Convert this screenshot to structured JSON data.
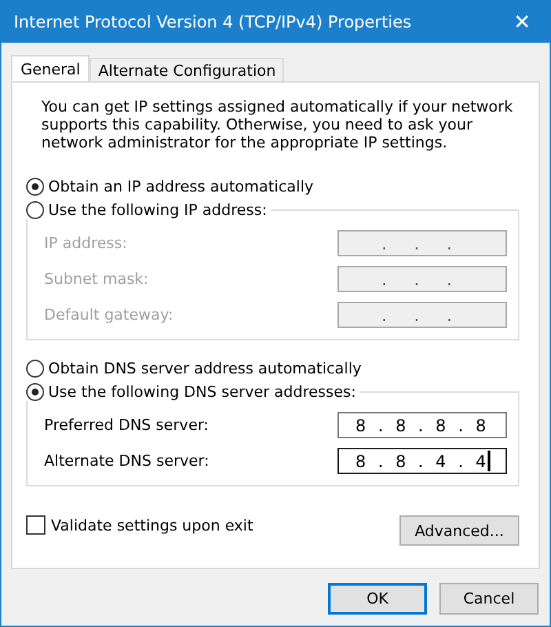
{
  "window": {
    "title": "Internet Protocol Version 4 (TCP/IPv4) Properties",
    "close": "✕"
  },
  "tabs": [
    {
      "label": "General",
      "selected": true
    },
    {
      "label": "Alternate Configuration",
      "selected": false
    }
  ],
  "intro": "You can get IP settings assigned automatically if your network supports this capability. Otherwise, you need to ask your network administrator for the appropriate IP settings.",
  "ip_mode": [
    {
      "label": "Obtain an IP address automatically",
      "selected": true
    },
    {
      "label": "Use the following IP address:",
      "selected": false
    }
  ],
  "ip_fields": [
    {
      "label": "IP address:",
      "value": ". . .",
      "disabled": true,
      "focused": false
    },
    {
      "label": "Subnet mask:",
      "value": ". . .",
      "disabled": true,
      "focused": false
    },
    {
      "label": "Default gateway:",
      "value": ". . .",
      "disabled": true,
      "focused": false
    }
  ],
  "dns_mode": [
    {
      "label": "Obtain DNS server address automatically",
      "selected": false
    },
    {
      "label": "Use the following DNS server addresses:",
      "selected": true
    }
  ],
  "dns_fields": [
    {
      "label": "Preferred DNS server:",
      "value": "8 . 8 . 8 . 8",
      "disabled": false,
      "focused": false
    },
    {
      "label": "Alternate DNS server:",
      "value": "8 . 8 . 4 . 4",
      "disabled": false,
      "focused": true
    }
  ],
  "validate": {
    "label": "Validate settings upon exit",
    "checked": false
  },
  "advanced_button": "Advanced...",
  "buttons": [
    {
      "label": "OK",
      "default": true
    },
    {
      "label": "Cancel",
      "default": false
    }
  ]
}
